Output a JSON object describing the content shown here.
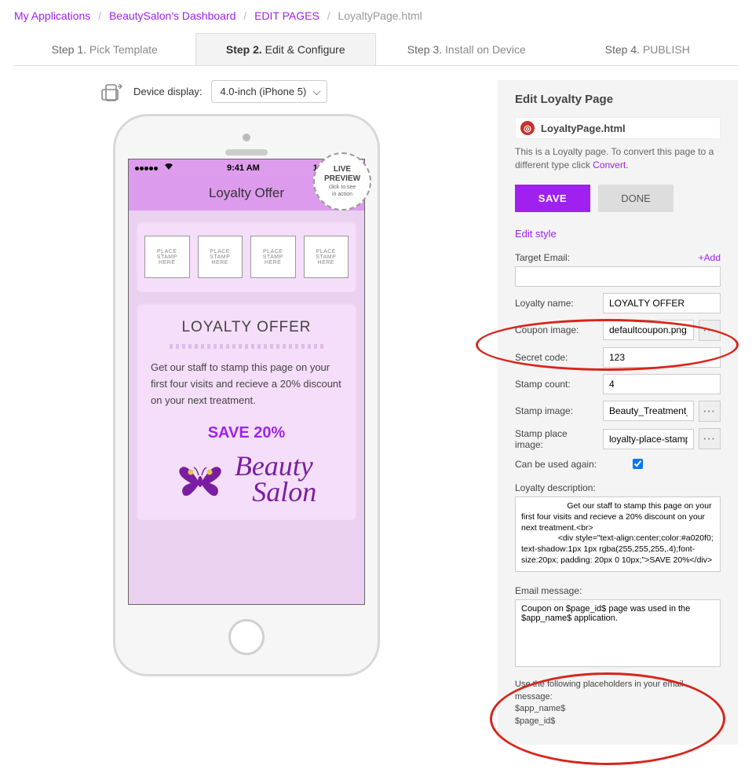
{
  "breadcrumb": {
    "items": [
      {
        "label": "My Applications"
      },
      {
        "label": "BeautySalon's Dashboard"
      },
      {
        "label": "EDIT PAGES"
      }
    ],
    "current": "LoyaltyPage.html"
  },
  "steps": [
    {
      "num": "Step 1.",
      "label": "Pick Template"
    },
    {
      "num": "Step 2.",
      "label": "Edit & Configure"
    },
    {
      "num": "Step 3.",
      "label": "Install on Device"
    },
    {
      "num": "Step 4.",
      "label": "PUBLISH"
    }
  ],
  "device_bar": {
    "label": "Device display:",
    "selected": "4.0-inch (iPhone 5)"
  },
  "live_preview": {
    "l1": "LIVE",
    "l2": "PREVIEW",
    "l3": "click to see",
    "l4": "in action"
  },
  "phone": {
    "status": {
      "time": "9:41 AM",
      "battery": "100%"
    },
    "title": "Loyalty Offer",
    "stamp_lines": [
      "PLACE",
      "STAMP",
      "HERE"
    ],
    "offer_title": "LOYALTY OFFER",
    "offer_text": "Get our staff to stamp this page on your first four visits and recieve a 20% discount on your next treatment.",
    "offer_save": "SAVE 20%",
    "logo_l1": "Beauty",
    "logo_l2": "Salon"
  },
  "panel": {
    "title": "Edit Loyalty Page",
    "file_name": "LoyaltyPage.html",
    "hint_pre": "This is a Loyalty page. To convert this page to a different type click ",
    "hint_link": "Convert",
    "hint_post": ".",
    "save": "SAVE",
    "done": "DONE",
    "edit_style": "Edit style",
    "labels": {
      "target_email": "Target Email:",
      "add": "+Add",
      "loyalty_name": "Loyalty name:",
      "coupon_image": "Coupon image:",
      "secret_code": "Secret code:",
      "stamp_count": "Stamp count:",
      "stamp_image": "Stamp image:",
      "stamp_place_image": "Stamp place image:",
      "can_reuse": "Can be used again:",
      "loyalty_desc": "Loyalty description:",
      "email_msg": "Email message:",
      "placeholders_hint": "Use the following placeholders in your email message:",
      "ph1": "$app_name$",
      "ph2": "$page_id$"
    },
    "values": {
      "target_email": "",
      "loyalty_name": "LOYALTY OFFER",
      "coupon_image": "defaultcoupon.png",
      "secret_code": "123",
      "stamp_count": "4",
      "stamp_image": "Beauty_Treatment_",
      "stamp_place_image": "loyalty-place-stamp",
      "can_reuse": true,
      "loyalty_desc": "                    Get our staff to stamp this page on your first four visits and recieve a 20% discount on your next treatment.<br>\n                <div style=\"text-align:center;color:#a020f0; text-shadow:1px 1px rgba(255,255,255,.4);font-size:20px; padding: 20px 0 10px;\">SAVE 20%</div>",
      "email_msg": "Coupon on $page_id$ page was used in the $app_name$ application."
    }
  }
}
